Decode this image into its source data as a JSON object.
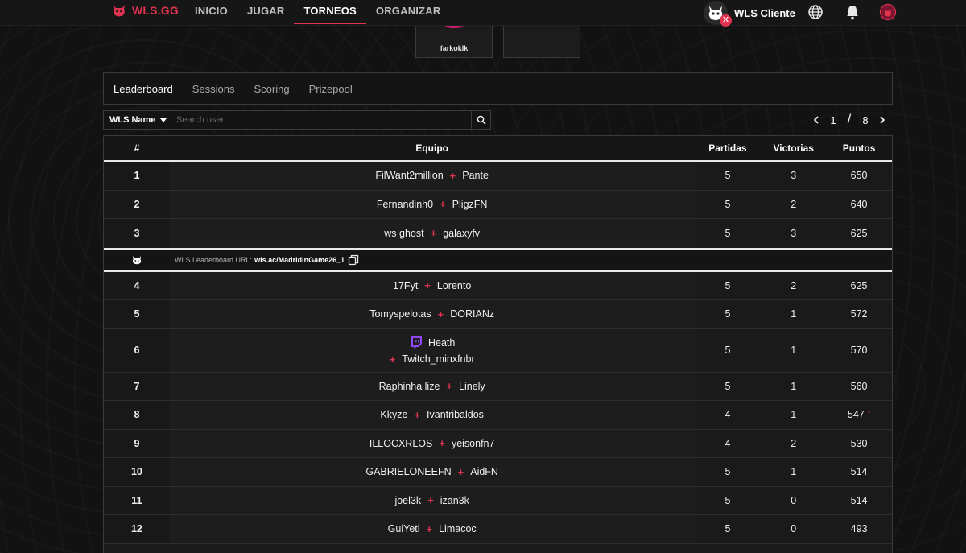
{
  "app": {
    "brand": "WLS.GG",
    "accent": "#e0334f"
  },
  "nav": {
    "items": [
      {
        "label": "INICIO",
        "active": false
      },
      {
        "label": "JUGAR",
        "active": false
      },
      {
        "label": "TORNEOS",
        "active": true
      },
      {
        "label": "ORGANIZAR",
        "active": false
      }
    ]
  },
  "header_tools": {
    "client_label": "WLS Cliente",
    "client_badge": "✕",
    "icons": [
      "globe-icon",
      "bell-icon",
      "profile-icon"
    ]
  },
  "team_cards": [
    {
      "name": "farkoklk"
    },
    {
      "name": ""
    }
  ],
  "tabs": [
    {
      "label": "Leaderboard",
      "active": true
    },
    {
      "label": "Sessions",
      "active": false
    },
    {
      "label": "Scoring",
      "active": false
    },
    {
      "label": "Prizepool",
      "active": false
    }
  ],
  "filter": {
    "select_value": "WLS Name",
    "search_placeholder": "Search user"
  },
  "pager": {
    "current": "1",
    "separator": "/",
    "total": "8"
  },
  "table": {
    "headers": {
      "rank": "#",
      "team": "Equipo",
      "games": "Partidas",
      "wins": "Victorias",
      "points": "Puntos"
    },
    "rows_top": [
      {
        "rank": "1",
        "p1": "FilWant2million",
        "p2": "Pante",
        "games": "5",
        "wins": "3",
        "points": "650"
      },
      {
        "rank": "2",
        "p1": "Fernandinh0",
        "p2": "PligzFN",
        "games": "5",
        "wins": "2",
        "points": "640"
      },
      {
        "rank": "3",
        "p1": "ws ghost",
        "p2": "galaxyfv",
        "games": "5",
        "wins": "3",
        "points": "625"
      }
    ],
    "url_row": {
      "label": "WLS Leaderboard URL:",
      "url": "wls.ac/MadridInGame26_1"
    },
    "rows_mid": [
      {
        "rank": "4",
        "p1": "17Fyt",
        "p2": "Lorento",
        "games": "5",
        "wins": "2",
        "points": "625"
      },
      {
        "rank": "5",
        "p1": "Tomyspelotas",
        "p2": "DORIANz",
        "games": "5",
        "wins": "1",
        "points": "572"
      }
    ],
    "row_six": {
      "rank": "6",
      "p1": "Heath",
      "p2": "Twitch_minxfnbr",
      "games": "5",
      "wins": "1",
      "points": "570"
    },
    "rows_bottom": [
      {
        "rank": "7",
        "p1": "Raphinha lize",
        "p2": "Linely",
        "games": "5",
        "wins": "1",
        "points": "560"
      },
      {
        "rank": "8",
        "p1": "Kkyze",
        "p2": "Ivantribaldos",
        "games": "4",
        "wins": "1",
        "points": "547",
        "mark": "*"
      },
      {
        "rank": "9",
        "p1": "ILLOCXRLOS",
        "p2": "yeisonfn7",
        "games": "4",
        "wins": "2",
        "points": "530"
      },
      {
        "rank": "10",
        "p1": "GABRIELONEEFN",
        "p2": "AidFN",
        "games": "5",
        "wins": "1",
        "points": "514"
      },
      {
        "rank": "11",
        "p1": "joel3k",
        "p2": "izan3k",
        "games": "5",
        "wins": "0",
        "points": "514"
      },
      {
        "rank": "12",
        "p1": "GuiYeti",
        "p2": "Limacoc",
        "games": "5",
        "wins": "0",
        "points": "493"
      }
    ],
    "plus_glyph": "+"
  }
}
